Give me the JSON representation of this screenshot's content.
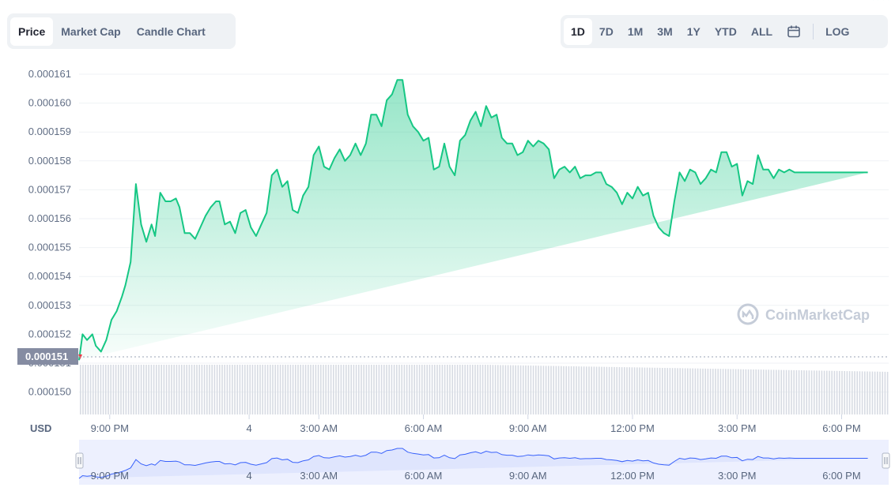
{
  "tabs": [
    {
      "label": "Price",
      "active": true
    },
    {
      "label": "Market Cap",
      "active": false
    },
    {
      "label": "Candle Chart",
      "active": false
    }
  ],
  "ranges": [
    {
      "label": "1D",
      "active": true
    },
    {
      "label": "7D",
      "active": false
    },
    {
      "label": "1M",
      "active": false
    },
    {
      "label": "3M",
      "active": false
    },
    {
      "label": "1Y",
      "active": false
    },
    {
      "label": "YTD",
      "active": false
    },
    {
      "label": "ALL",
      "active": false
    }
  ],
  "calendar_icon": "calendar-icon",
  "log_label": "LOG",
  "currency_label": "USD",
  "watermark": "CoinMarketCap",
  "current_price_label": "0.000151",
  "colors": {
    "line": "#16c784",
    "down": "#ea3943",
    "volume": "#d7dbe3",
    "navigator": "#3861fb",
    "label_bg": "#858ca2"
  },
  "chart_data": {
    "type": "area",
    "title": "",
    "ylabel": "",
    "xlabel": "",
    "yticks": [
      "0.000161",
      "0.000160",
      "0.000159",
      "0.000158",
      "0.000157",
      "0.000156",
      "0.000155",
      "0.000154",
      "0.000153",
      "0.000152",
      "0.000151",
      "0.000150"
    ],
    "ylim": [
      0.00015,
      0.0001612
    ],
    "xticks": [
      "9:00 PM",
      "4",
      "3:00 AM",
      "6:00 AM",
      "9:00 AM",
      "12:00 PM",
      "3:00 PM",
      "6:00 PM"
    ],
    "xlim_hours": [
      -0.88,
      22.35
    ],
    "grid": true,
    "series": [
      {
        "x_hours": [
          -0.88,
          -0.78,
          -0.65,
          -0.5,
          -0.4,
          -0.25,
          -0.1,
          0.05,
          0.2,
          0.35,
          0.45,
          0.6,
          0.75,
          0.9,
          1.05,
          1.2,
          1.3,
          1.45,
          1.6,
          1.75,
          1.9,
          2.0,
          2.15,
          2.3,
          2.45,
          2.6,
          2.75,
          2.9,
          3.05,
          3.15,
          3.3,
          3.45,
          3.6,
          3.75,
          3.9,
          4.05,
          4.2,
          4.35,
          4.5,
          4.65,
          4.8,
          4.95,
          5.1,
          5.25,
          5.4,
          5.55,
          5.7,
          5.85,
          6.0,
          6.15,
          6.3,
          6.45,
          6.6,
          6.75,
          6.9,
          7.05,
          7.2,
          7.35,
          7.5,
          7.65,
          7.8,
          7.95,
          8.1,
          8.25,
          8.4,
          8.55,
          8.7,
          8.85,
          9.0,
          9.15,
          9.3,
          9.45,
          9.6,
          9.75,
          9.9,
          10.05,
          10.2,
          10.35,
          10.5,
          10.65,
          10.8,
          10.95,
          11.1,
          11.25,
          11.4,
          11.55,
          11.7,
          11.85,
          12.0,
          12.15,
          12.3,
          12.45,
          12.6,
          12.75,
          12.9,
          13.05,
          13.2,
          13.35,
          13.5,
          13.65,
          13.8,
          13.95,
          14.1,
          14.25,
          14.4,
          14.55,
          14.7,
          14.85,
          15.0,
          15.15,
          15.3,
          15.45,
          15.6,
          15.75,
          15.9,
          16.05,
          16.2,
          16.35,
          16.5,
          16.65,
          16.8,
          16.95,
          17.1,
          17.25,
          17.4,
          17.55,
          17.7,
          17.85,
          18.0,
          18.15,
          18.3,
          18.45,
          18.6,
          18.75,
          18.9,
          19.05,
          19.2,
          19.35,
          19.5,
          19.65,
          19.8,
          19.95,
          20.1,
          20.25,
          20.4,
          20.55,
          20.7,
          20.85,
          21.0,
          21.15,
          21.3,
          21.45,
          21.6,
          21.75,
          21.9,
          22.05,
          22.2,
          22.35
        ],
        "values": [
          0.0001511,
          0.000152,
          0.0001518,
          0.000152,
          0.0001516,
          0.0001514,
          0.0001518,
          0.0001525,
          0.0001528,
          0.0001533,
          0.0001537,
          0.0001545,
          0.0001572,
          0.0001558,
          0.0001552,
          0.0001558,
          0.0001554,
          0.0001569,
          0.0001566,
          0.0001566,
          0.0001567,
          0.0001564,
          0.0001555,
          0.0001555,
          0.0001553,
          0.0001557,
          0.0001561,
          0.0001564,
          0.0001566,
          0.0001566,
          0.0001558,
          0.0001559,
          0.0001555,
          0.0001562,
          0.0001563,
          0.0001557,
          0.0001554,
          0.0001558,
          0.0001562,
          0.0001575,
          0.0001577,
          0.0001571,
          0.0001573,
          0.0001563,
          0.0001562,
          0.0001568,
          0.0001571,
          0.0001582,
          0.0001585,
          0.0001578,
          0.0001577,
          0.0001581,
          0.0001584,
          0.000158,
          0.0001582,
          0.0001586,
          0.0001582,
          0.0001586,
          0.0001596,
          0.0001596,
          0.0001592,
          0.0001601,
          0.0001603,
          0.0001608,
          0.0001608,
          0.0001596,
          0.0001592,
          0.000159,
          0.0001587,
          0.0001588,
          0.0001577,
          0.0001578,
          0.0001586,
          0.0001578,
          0.0001575,
          0.0001587,
          0.0001589,
          0.0001594,
          0.0001597,
          0.0001592,
          0.0001599,
          0.0001595,
          0.0001596,
          0.0001588,
          0.0001586,
          0.0001586,
          0.0001582,
          0.0001583,
          0.0001587,
          0.0001585,
          0.0001587,
          0.0001586,
          0.0001584,
          0.0001574,
          0.0001577,
          0.0001578,
          0.0001576,
          0.0001578,
          0.0001574,
          0.0001575,
          0.0001575,
          0.0001576,
          0.0001576,
          0.0001572,
          0.0001571,
          0.0001569,
          0.0001565,
          0.0001569,
          0.0001567,
          0.0001571,
          0.0001568,
          0.0001569,
          0.0001561,
          0.0001557,
          0.0001555,
          0.0001554,
          0.0001566,
          0.0001576,
          0.0001573,
          0.0001577,
          0.0001576,
          0.0001572,
          0.0001574,
          0.0001577,
          0.0001576,
          0.0001583,
          0.0001583,
          0.0001578,
          0.0001579,
          0.0001568,
          0.0001573,
          0.0001572,
          0.0001582,
          0.0001577,
          0.0001577,
          0.0001574,
          0.0001577,
          0.0001576,
          0.0001577,
          0.0001576,
          0.0001576,
          0.0001576,
          0.0001576,
          0.0001576,
          0.0001576,
          0.0001576,
          0.0001576,
          0.0001576,
          0.0001576,
          0.0001576,
          0.0001576,
          0.0001576,
          0.0001576,
          0.0001576
        ]
      }
    ]
  }
}
